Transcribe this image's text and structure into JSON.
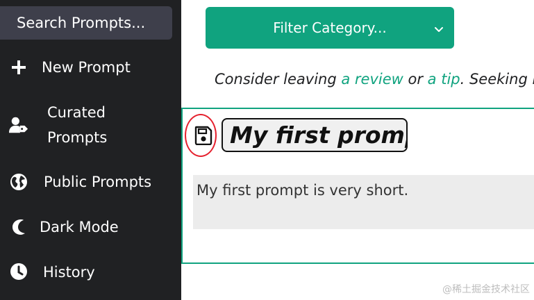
{
  "sidebar": {
    "search_placeholder": "Search Prompts...",
    "items": [
      {
        "label": "New Prompt",
        "icon": "plus-icon"
      },
      {
        "label_line1": "Curated",
        "label_line2": "Prompts",
        "icon": "user-tag-icon"
      },
      {
        "label": "Public Prompts",
        "icon": "globe-icon"
      },
      {
        "label": "Dark Mode",
        "icon": "moon-icon"
      },
      {
        "label": "History",
        "icon": "clock-icon"
      }
    ]
  },
  "main": {
    "filter_label": "Filter Category...",
    "notice": {
      "part1": "Consider leaving ",
      "review_link": "a review",
      "part2": " or ",
      "tip_link": "a tip",
      "part3": ". Seeking ne"
    },
    "prompt": {
      "title": "My first prompt",
      "body": "My first prompt is very short."
    }
  },
  "watermark": "@稀土掘金技术社区",
  "colors": {
    "sidebar_bg": "#202123",
    "search_bg": "#3e3f4b",
    "accent": "#10a37f",
    "highlight_circle": "#e5212e"
  }
}
